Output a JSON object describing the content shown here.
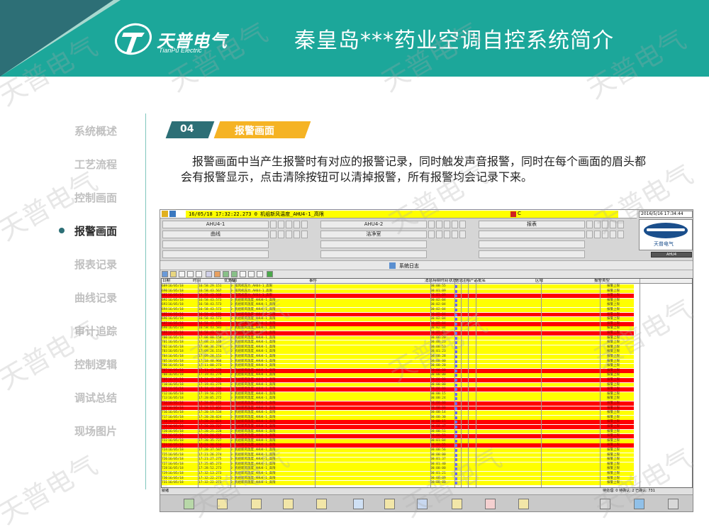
{
  "header": {
    "logo_cn": "天普电气",
    "logo_en": "TianPu Electric",
    "title": "秦皇岛***药业空调自控系统简介"
  },
  "nav": {
    "items": [
      {
        "label": "系统概述"
      },
      {
        "label": "工艺流程"
      },
      {
        "label": "控制画面"
      },
      {
        "label": "报警画面"
      },
      {
        "label": "报表记录"
      },
      {
        "label": "曲线记录"
      },
      {
        "label": "审计追踪"
      },
      {
        "label": "控制逻辑"
      },
      {
        "label": "调试总结"
      },
      {
        "label": "现场图片"
      }
    ],
    "active_index": 3
  },
  "section": {
    "number": "04",
    "label": "报警画面",
    "description": "报警画面中当产生报警时有对应的报警记录，同时触发声音报警，同时在每个画面的眉头都会有报警显示，点击清除按钮可以清掉报警，所有报警均会记录下来。"
  },
  "screenshot": {
    "alarm_message": "16/05/18 17:32:22.273 0  机组新风温度_AHU4-1_高限",
    "alarm_flag": "C",
    "datetime": "2016/5/16 17:34:44",
    "logo_text": "天普电气",
    "ahu_label": "AHU4",
    "nav_buttons": {
      "ahu1": "AHU4-1",
      "ahu2": "AHU4-2",
      "report": "报表",
      "curve": "曲线",
      "clean": "洁净室"
    },
    "syslog_title": "系统日志",
    "columns": [
      "日期",
      "时间",
      "优先级",
      "来源",
      "事件",
      "消息持续时间",
      "状态",
      "信息",
      "注释",
      "产品批名",
      "区域",
      "报警类型"
    ],
    "rows": [
      {
        "id": "689",
        "date": "16/05/18",
        "time": "16:58:29.151",
        "pri": "0",
        "src": "排风机压力_AHU4-1_高限",
        "dur": "00:00:55",
        "type": "报警上限",
        "red": false
      },
      {
        "id": "690",
        "date": "16/05/18",
        "time": "16:58:43.567",
        "pri": "0",
        "src": "排风机压力_AHU4-1_高限",
        "dur": "00:01:09",
        "type": "报警上限",
        "red": false
      },
      {
        "id": "691",
        "date": "16/05/18",
        "time": "16:58:43.568",
        "pri": "0",
        "src": "排风机压力_AHU4-1_高限",
        "dur": "00:01:09",
        "type": "报警上限",
        "red": true
      },
      {
        "id": "692",
        "date": "16/05/18",
        "time": "16:58:43.573",
        "pri": "0",
        "src": "机组新风温度_AHU4-1_高限",
        "dur": "00:02:04",
        "type": "报警上限",
        "red": false
      },
      {
        "id": "693",
        "date": "16/05/18",
        "time": "16:58:43.573",
        "pri": "0",
        "src": "机组新风温度_AHU4-1_高限",
        "dur": "00:02:04",
        "type": "报警上限",
        "red": false
      },
      {
        "id": "694",
        "date": "16/05/18",
        "time": "16:58:43.573",
        "pri": "0",
        "src": "机组新风温度_AHU4-1_高限",
        "dur": "00:02:04",
        "type": "报警上限",
        "red": false
      },
      {
        "id": "695",
        "date": "16/05/18",
        "time": "16:58:43.573",
        "pri": "0",
        "src": "机组新风温度_AHU4-1_高限",
        "dur": "00:02:04",
        "type": "报警上限",
        "red": true
      },
      {
        "id": "696",
        "date": "16/05/18",
        "time": "16:58:43.573",
        "pri": "0",
        "src": "机组新风温度_AHU4-1_高限",
        "dur": "00:02:04",
        "type": "报警上限",
        "red": false
      },
      {
        "id": "697",
        "date": "16/05/18",
        "time": "16:58:43.573",
        "pri": "0",
        "src": "机组新风温度_AHU4-1_高限",
        "dur": "00:02:04",
        "type": "报警上限",
        "red": true
      },
      {
        "id": "698",
        "date": "16/05/18",
        "time": "16:58:43.583",
        "pri": "0",
        "src": "机组新风温度_AHU4-1_高限",
        "dur": "00:02:04",
        "type": "报警上限",
        "red": false
      },
      {
        "id": "699",
        "date": "16/05/18",
        "time": "16:58:43.583",
        "pri": "0",
        "src": "机组新风温度_AHU4-1_高限",
        "dur": "00:02:04",
        "type": "报警上限",
        "red": true
      },
      {
        "id": "700",
        "date": "16/05/18",
        "time": "17:08:00.150",
        "pri": "0",
        "src": "机组新风温度_AHU4-1_高限",
        "dur": "00:06:20",
        "type": "报警上限",
        "red": false
      },
      {
        "id": "701",
        "date": "16/05/18",
        "time": "17:08:23.160",
        "pri": "0",
        "src": "机组新风温度_AHU4-1_高限",
        "dur": "00:00:23",
        "type": "报警上限",
        "red": false
      },
      {
        "id": "702",
        "date": "16/05/18",
        "time": "17:08:36.278",
        "pri": "0",
        "src": "机组新风温度_AHU4-1_高限",
        "dur": "00:00:53",
        "type": "报警上限",
        "red": false
      },
      {
        "id": "703",
        "date": "16/05/18",
        "time": "17:09:26.151",
        "pri": "0",
        "src": "机组新风温度_AHU4-1_高限",
        "dur": "00:01:23",
        "type": "报警上限",
        "red": false
      },
      {
        "id": "704",
        "date": "16/05/18",
        "time": "17:09:28.151",
        "pri": "0",
        "src": "机组新风温度_AHU4-1_高限",
        "dur": "00:00:28",
        "type": "报警上限",
        "red": false
      },
      {
        "id": "705",
        "date": "16/05/18",
        "time": "17:10:40.966",
        "pri": "0",
        "src": "机组新风温度_AHU4-1_高限",
        "dur": "00:00:00",
        "type": "报警上限",
        "red": false
      },
      {
        "id": "706",
        "date": "16/05/18",
        "time": "17:11:00.273",
        "pri": "0",
        "src": "机组新风温度_AHU4-1_高限",
        "dur": "00:00:20",
        "type": "报警上限",
        "red": false
      },
      {
        "id": "707",
        "date": "16/05/18",
        "time": "17:11:41.279",
        "pri": "0",
        "src": "机组新风温度_AHU4-1_高限",
        "dur": "00:00:00",
        "type": "报警上限",
        "red": true
      },
      {
        "id": "708",
        "date": "16/05/18",
        "time": "17:19:41.279",
        "pri": "0",
        "src": "机组新风温度_AHU4-1_高限",
        "dur": "00:00:00",
        "type": "报警上限",
        "red": false
      },
      {
        "id": "709",
        "date": "16/05/18",
        "time": "17:19:41.279",
        "pri": "0",
        "src": "机组新风温度_AHU4-1_高限",
        "dur": "00:00:00",
        "type": "报警上限",
        "red": true
      },
      {
        "id": "710",
        "date": "16/05/18",
        "time": "17:19:41.279",
        "pri": "0",
        "src": "机组新风温度_AHU4-1_高限",
        "dur": "00:00:00",
        "type": "报警上限",
        "red": false
      },
      {
        "id": "711",
        "date": "16/05/18",
        "time": "17:19:41.280",
        "pri": "0",
        "src": "机组新风温度_AHU4-1_高限",
        "dur": "00:00:00",
        "type": "报警上限",
        "red": true
      },
      {
        "id": "712",
        "date": "16/05/18",
        "time": "17:19:56.272",
        "pri": "0",
        "src": "机组新风温度_AHU4-1_高限",
        "dur": "00:00:15",
        "type": "报警上限",
        "red": false
      },
      {
        "id": "713",
        "date": "16/05/18",
        "time": "17:20:05.272",
        "pri": "0",
        "src": "机组新风温度_AHU4-1_高限",
        "dur": "00:00:24",
        "type": "报警上限",
        "red": false
      },
      {
        "id": "714",
        "date": "16/05/18",
        "time": "17:20:05.272",
        "pri": "0",
        "src": "机组新风温度_AHU4-1_高限",
        "dur": "00:00:00",
        "type": "报警上限",
        "red": true
      },
      {
        "id": "715",
        "date": "16/05/18",
        "time": "17:20:17.052",
        "pri": "0",
        "src": "机组新风温度_AHU4-1_高限",
        "dur": "00:00:00",
        "type": "报警上限",
        "red": true
      },
      {
        "id": "716",
        "date": "16/05/18",
        "time": "17:20:19.534",
        "pri": "0",
        "src": "机组新风温度_AHU4-1_高限",
        "dur": "00:00:14",
        "type": "报警上限",
        "red": false
      },
      {
        "id": "717",
        "date": "16/05/18",
        "time": "17:20:20.024",
        "pri": "0",
        "src": "机组新风温度_AHU4-1_高限",
        "dur": "00:00:30",
        "type": "报警上限",
        "red": false
      },
      {
        "id": "718",
        "date": "16/05/18",
        "time": "17:20:22.024",
        "pri": "0",
        "src": "机组新风温度_AHU4-1_高限",
        "dur": "00:00:15",
        "type": "报警上限",
        "red": true
      },
      {
        "id": "719",
        "date": "16/05/18",
        "time": "17:20:23.727",
        "pri": "0",
        "src": "机组新风温度_AHU4-1_高限",
        "dur": "00:00:47",
        "type": "报警上限",
        "red": true
      },
      {
        "id": "720",
        "date": "16/05/18",
        "time": "17:20:25.220",
        "pri": "0",
        "src": "机组新风温度_AHU4-1_高限",
        "dur": "00:00:51",
        "type": "报警上限",
        "red": false
      },
      {
        "id": "721",
        "date": "16/05/18",
        "time": "17:20:26.727",
        "pri": "0",
        "src": "机组新风温度_AHU4-1_高限",
        "dur": "00:00:53",
        "type": "报警上限",
        "red": true
      },
      {
        "id": "722",
        "date": "16/05/18",
        "time": "17:20:35.727",
        "pri": "0",
        "src": "机组新风温度_AHU4-1_高限",
        "dur": "00:01:04",
        "type": "报警上限",
        "red": false
      },
      {
        "id": "723",
        "date": "16/05/18",
        "time": "17:20:36.534",
        "pri": "0",
        "src": "机组新风温度_AHU4-1_高限",
        "dur": "00:00:55",
        "type": "报警上限",
        "red": true
      },
      {
        "id": "724",
        "date": "16/05/18",
        "time": "17:20:37.587",
        "pri": "0",
        "src": "机组新风温度_AHU4-1_高限",
        "dur": "00:00:56",
        "type": "报警上限",
        "red": false
      },
      {
        "id": "725",
        "date": "16/05/18",
        "time": "17:21:26.274",
        "pri": "0",
        "src": "机组新风温度_AHU4-1_高限",
        "dur": "00:00:00",
        "type": "报警上限",
        "red": false
      },
      {
        "id": "726",
        "date": "16/05/18",
        "time": "17:21:27.275",
        "pri": "0",
        "src": "机组新风温度_AHU4-1_高限",
        "dur": "00:01:37",
        "type": "报警上限",
        "red": false
      },
      {
        "id": "727",
        "date": "16/05/18",
        "time": "17:25:05.273",
        "pri": "0",
        "src": "机组新风温度_AHU4-1_高限",
        "dur": "00:01:40",
        "type": "报警上限",
        "red": false
      },
      {
        "id": "728",
        "date": "16/05/18",
        "time": "17:28:52.273",
        "pri": "0",
        "src": "机组新风温度_AHU4-1_高限",
        "dur": "00:00:00",
        "type": "报警上限",
        "red": false
      },
      {
        "id": "729",
        "date": "16/05/18",
        "time": "17:32:13.273",
        "pri": "0",
        "src": "机组新风温度_AHU4-1_高限",
        "dur": "00:01:21",
        "type": "报警上限",
        "red": false
      },
      {
        "id": "730",
        "date": "16/05/18",
        "time": "17:32:22.273",
        "pri": "0",
        "src": "机组新风温度_AHU4-1_高限",
        "dur": "00:00:09",
        "type": "报警上限",
        "red": false
      },
      {
        "id": "731",
        "date": "16/05/18",
        "time": "17:32:22.273",
        "pri": "0",
        "src": "机组新风温度_AHU4-1_高限",
        "dur": "00:00:00",
        "type": "报警上限",
        "red": false
      }
    ],
    "status_left": "就绪",
    "status_right": "待处理: 0  待确认: 2  已确认: 731",
    "colors": {
      "yellow_row": "#ffff00",
      "red_row": "#ff0000",
      "header_bg": "#1ca79a"
    }
  },
  "watermark": "天普电气"
}
